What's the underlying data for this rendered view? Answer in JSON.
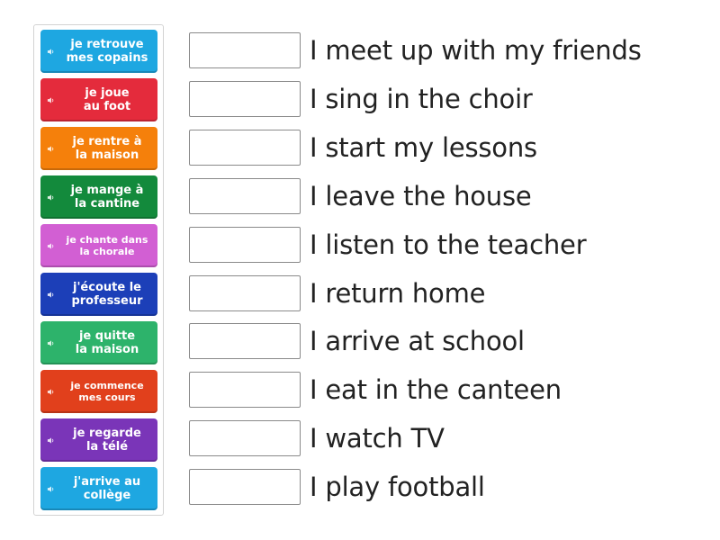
{
  "tiles": [
    {
      "label": "je retrouve\nmes copains",
      "color": "#1ea7e1",
      "icon": "speaker-icon"
    },
    {
      "label": "je joue\nau foot",
      "color": "#e42b3c",
      "icon": "speaker-icon"
    },
    {
      "label": "je rentre à\nla maison",
      "color": "#f5800b",
      "icon": "speaker-icon"
    },
    {
      "label": "je mange à\nla cantine",
      "color": "#138a3c",
      "icon": "speaker-icon"
    },
    {
      "label": "je chante dans\nla chorale",
      "color": "#d25fd3",
      "icon": "speaker-icon"
    },
    {
      "label": "j'écoute le\nprofesseur",
      "color": "#1c3fb8",
      "icon": "speaker-icon"
    },
    {
      "label": "je quitte\nla maison",
      "color": "#2db36b",
      "icon": "speaker-icon"
    },
    {
      "label": "je commence\nmes cours",
      "color": "#e1401c",
      "icon": "speaker-icon"
    },
    {
      "label": "je regarde\nla télé",
      "color": "#7a35b8",
      "icon": "speaker-icon"
    },
    {
      "label": "j'arrive au\ncollège",
      "color": "#1ea7e1",
      "icon": "speaker-icon"
    }
  ],
  "rows": [
    {
      "text": "I meet up with my friends"
    },
    {
      "text": "I sing in the choir"
    },
    {
      "text": "I start my lessons"
    },
    {
      "text": "I leave the house"
    },
    {
      "text": "I listen to the teacher"
    },
    {
      "text": "I return home"
    },
    {
      "text": "I arrive at school"
    },
    {
      "text": "I eat in the canteen"
    },
    {
      "text": "I watch TV"
    },
    {
      "text": "I play football"
    }
  ]
}
